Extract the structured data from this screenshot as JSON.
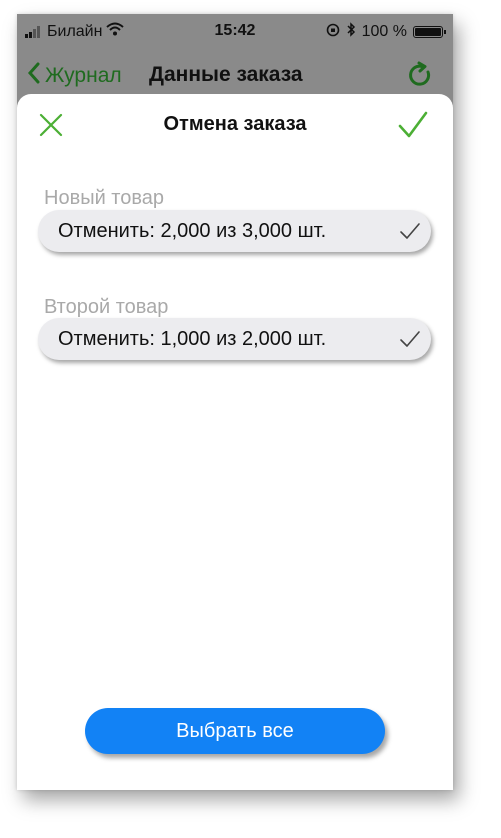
{
  "status_bar": {
    "carrier": "Билайн",
    "time": "15:42",
    "battery": "100 %"
  },
  "background_nav": {
    "back_label": "Журнал",
    "title": "Данные заказа"
  },
  "sheet": {
    "title": "Отмена заказа",
    "items": [
      {
        "section_label": "Новый товар",
        "value": "Отменить: 2,000 из 3,000 шт."
      },
      {
        "section_label": "Второй товар",
        "value": "Отменить: 1,000 из 2,000 шт."
      }
    ],
    "select_all_label": "Выбрать все"
  },
  "colors": {
    "accent_green": "#4caf35",
    "button_blue": "#1282f5",
    "label_gray": "#a9a9a9"
  },
  "icons": [
    "wifi-icon",
    "lock-rotation-icon",
    "bluetooth-icon",
    "battery-icon",
    "chevron-left-icon",
    "refresh-icon",
    "close-icon",
    "checkmark-icon"
  ]
}
